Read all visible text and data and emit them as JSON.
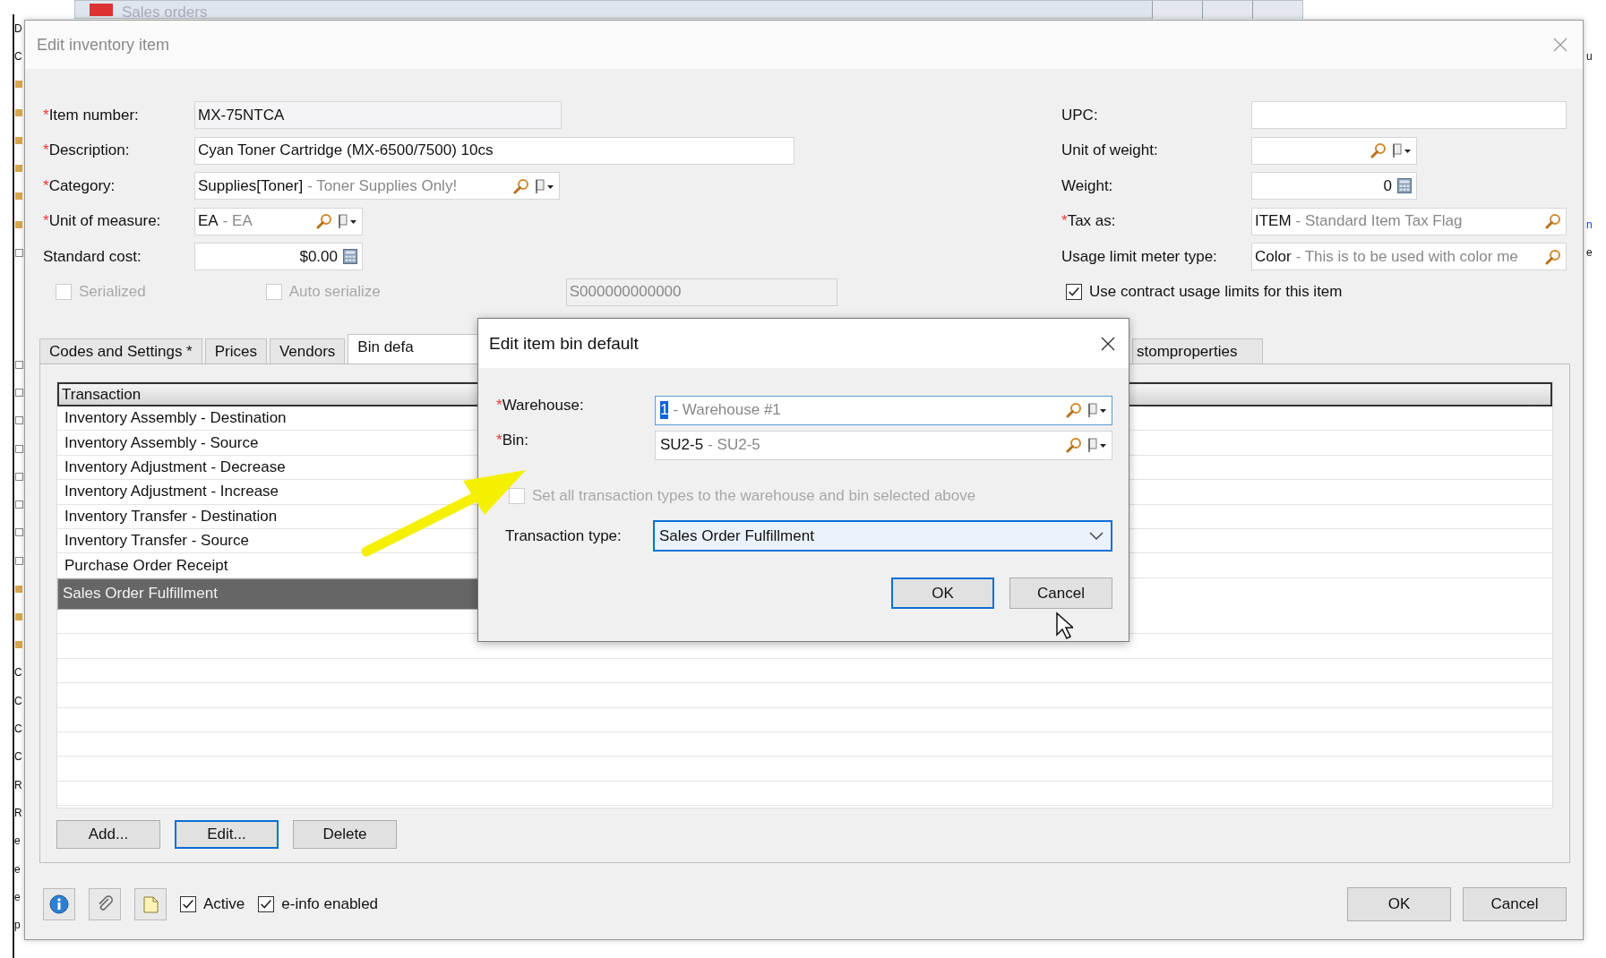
{
  "background_app": {
    "tab_title": "Sales orders",
    "left_strip": [
      {
        "kind": "letter",
        "text": "D"
      },
      {
        "kind": "letter",
        "text": "C"
      },
      {
        "kind": "folder"
      },
      {
        "kind": "folder"
      },
      {
        "kind": "folder"
      },
      {
        "kind": "folder"
      },
      {
        "kind": "folder"
      },
      {
        "kind": "folder"
      },
      {
        "kind": "expander"
      },
      {
        "kind": "blank"
      },
      {
        "kind": "blank"
      },
      {
        "kind": "blank"
      },
      {
        "kind": "expander"
      },
      {
        "kind": "expander"
      },
      {
        "kind": "expander"
      },
      {
        "kind": "expander"
      },
      {
        "kind": "expander"
      },
      {
        "kind": "expander"
      },
      {
        "kind": "expander"
      },
      {
        "kind": "expander"
      },
      {
        "kind": "folder"
      },
      {
        "kind": "folder"
      },
      {
        "kind": "folder"
      },
      {
        "kind": "letter",
        "text": "C"
      },
      {
        "kind": "letter",
        "text": "C"
      },
      {
        "kind": "letter",
        "text": "C"
      },
      {
        "kind": "letter",
        "text": "C"
      },
      {
        "kind": "letter",
        "text": "R"
      },
      {
        "kind": "letter",
        "text": "R"
      },
      {
        "kind": "letter",
        "text": "e"
      },
      {
        "kind": "letter",
        "text": "e"
      },
      {
        "kind": "letter",
        "text": "e"
      },
      {
        "kind": "letter",
        "text": "p"
      }
    ],
    "right_strip": [
      {
        "kind": "blank"
      },
      {
        "kind": "letter",
        "text": "u"
      },
      {
        "kind": "blank"
      },
      {
        "kind": "blank"
      },
      {
        "kind": "blank"
      },
      {
        "kind": "blank"
      },
      {
        "kind": "blank"
      },
      {
        "kind": "link",
        "text": "n"
      },
      {
        "kind": "letter",
        "text": "e"
      }
    ]
  },
  "window": {
    "title": "Edit inventory item"
  },
  "form_left": [
    {
      "mark": "*",
      "label": "Item number:",
      "kind": "text",
      "value": "MX-75NTCA"
    },
    {
      "mark": "*",
      "label": "Description:",
      "kind": "text",
      "value": "Cyan Toner Cartridge (MX-6500/7500) 10cs"
    },
    {
      "mark": "*",
      "label": "Category:",
      "kind": "lookup",
      "value": "Supplies[Toner]",
      "detail": "- Toner Supplies Only!"
    },
    {
      "mark": "*",
      "label": "Unit of measure:",
      "kind": "lookup",
      "value": "EA",
      "detail": "- EA"
    },
    {
      "label": "Standard cost:",
      "kind": "number",
      "value": "$0.00"
    }
  ],
  "options_row": [
    {
      "kind": "checkbox",
      "label": "Serialized",
      "checked": false,
      "disabled": true
    },
    {
      "kind": "checkbox",
      "label": "Auto serialize",
      "checked": false,
      "disabled": true
    },
    {
      "kind": "field",
      "value": "S000000000000",
      "disabled": true
    }
  ],
  "form_right": [
    {
      "label": "UPC:",
      "kind": "text"
    },
    {
      "label": "Unit of weight:",
      "kind": "lookup"
    },
    {
      "label": "Weight:",
      "kind": "number",
      "value": "0"
    },
    {
      "mark": "*",
      "label": "Tax as:",
      "kind": "search",
      "value": "ITEM",
      "detail": "- Standard Item Tax Flag"
    },
    {
      "label": "Usage limit meter type:",
      "kind": "search",
      "value": "Color",
      "detail": "- This is to be used with color me"
    }
  ],
  "contract_checkbox": {
    "label": "Use contract usage limits for this item",
    "checked": true
  },
  "tabs": [
    {
      "label": "Codes and Settings  *",
      "selected": false
    },
    {
      "label": "Prices",
      "selected": false
    },
    {
      "label": "Vendors",
      "selected": false
    },
    {
      "label": "Bin defa",
      "selected": true
    },
    {
      "label": "stomproperties",
      "selected": false
    }
  ],
  "grid": {
    "columns": [
      "Transaction"
    ],
    "rows": [
      {
        "text": "Inventory Assembly - Destination",
        "selected": false
      },
      {
        "text": "Inventory Assembly - Source",
        "selected": false
      },
      {
        "text": "Inventory Adjustment - Decrease",
        "selected": false
      },
      {
        "text": "Inventory Adjustment - Increase",
        "selected": false
      },
      {
        "text": "Inventory Transfer - Destination",
        "selected": false
      },
      {
        "text": "Inventory Transfer - Source",
        "selected": false
      },
      {
        "text": "Purchase Order Receipt",
        "selected": false
      },
      {
        "text": "Sales Order Fulfillment",
        "selected": true
      }
    ]
  },
  "grid_buttons": [
    {
      "label": "Add...",
      "focused": false
    },
    {
      "label": "Edit...",
      "focused": true
    },
    {
      "label": "Delete",
      "focused": false
    }
  ],
  "footer": {
    "icon_buttons": [
      {
        "kind": "info"
      },
      {
        "kind": "attach"
      },
      {
        "kind": "note"
      }
    ],
    "checkboxes": [
      {
        "label": "Active",
        "checked": true
      },
      {
        "label": "e-info enabled",
        "checked": true
      }
    ],
    "buttons": [
      {
        "label": "OK",
        "focused": false
      },
      {
        "label": "Cancel",
        "focused": false
      }
    ]
  },
  "dialog": {
    "title": "Edit item bin default",
    "fields": [
      {
        "mark": "*",
        "label": "Warehouse:",
        "value": "1",
        "detail": "- Warehouse #1",
        "focused": true
      },
      {
        "mark": "*",
        "label": "Bin:",
        "value": "SU2-5",
        "detail": "- SU2-5",
        "focused": false
      }
    ],
    "checkbox": {
      "label": "Set all transaction types to the warehouse and bin selected above",
      "checked": false,
      "disabled": true
    },
    "transaction_type": {
      "label": "Transaction type:",
      "value": "Sales Order Fulfillment",
      "focused": true
    },
    "buttons": [
      {
        "label": "OK",
        "focused": true
      },
      {
        "label": "Cancel",
        "focused": false
      }
    ]
  }
}
